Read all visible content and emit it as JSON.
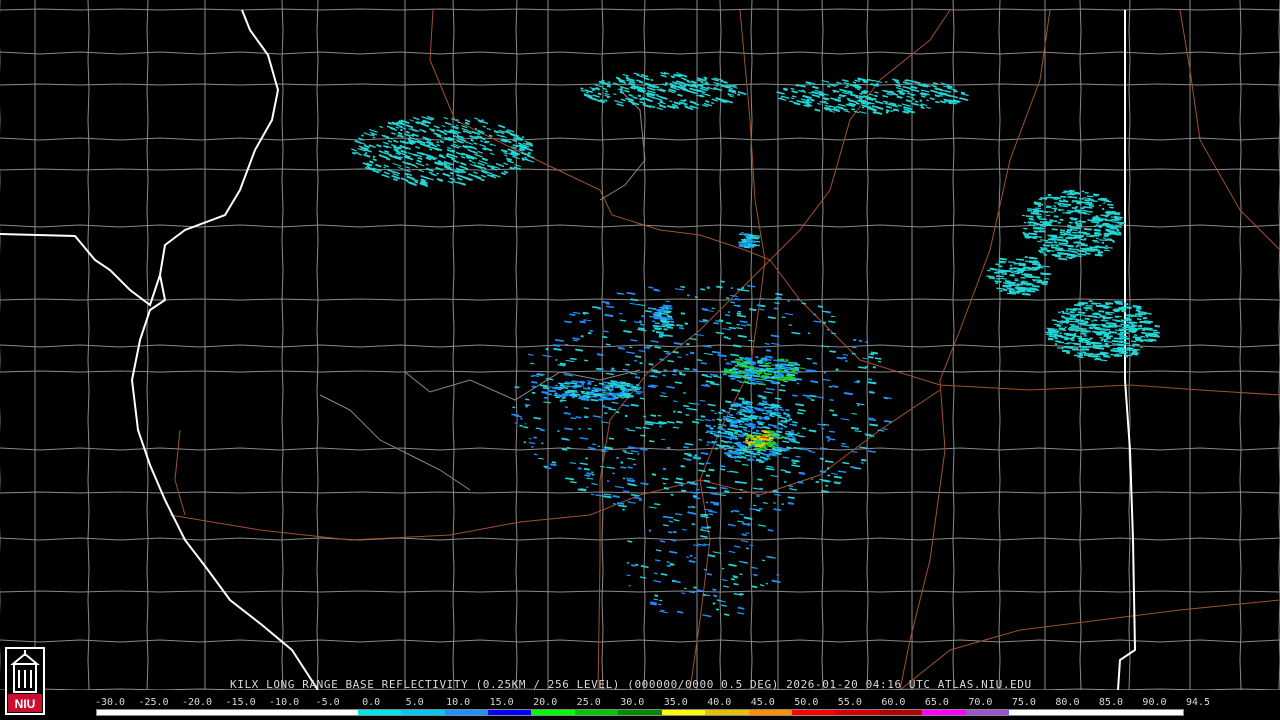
{
  "product": {
    "caption": "KILX LONG RANGE BASE REFLECTIVITY (0.25KM / 256 LEVEL) (000000/0000 0.5 DEG) 2026-01-20 04:16 UTC  ATLAS.NIU.EDU"
  },
  "logo": {
    "text": "NIU",
    "color": "#c8102e"
  },
  "scale": {
    "labels": [
      "-30.0",
      "-25.0",
      "-20.0",
      "-15.0",
      "-10.0",
      "-5.0",
      "0.0",
      "5.0",
      "10.0",
      "15.0",
      "20.0",
      "25.0",
      "30.0",
      "35.0",
      "40.0",
      "45.0",
      "50.0",
      "55.0",
      "60.0",
      "65.0",
      "70.0",
      "75.0",
      "80.0",
      "85.0",
      "90.0",
      "94.5"
    ],
    "colors": [
      "#ffffff",
      "#ffffff",
      "#ffffff",
      "#ffffff",
      "#ffffff",
      "#ffffff",
      "#00e6e6",
      "#00c8f0",
      "#1e90ff",
      "#0000ff",
      "#00ff00",
      "#00c800",
      "#008c00",
      "#ffff00",
      "#e8c000",
      "#ff9000",
      "#ff0000",
      "#d40000",
      "#b40000",
      "#ff00ff",
      "#9955c9",
      "#ffffff",
      "#ffffff",
      "#ffffff",
      "#ffffff"
    ]
  },
  "map_colors": {
    "county": "#8a8a8a",
    "state": "#ffffff",
    "highway": "#a0522d",
    "echo_light": "#22d6d6",
    "echo_mid": "#1e8fff",
    "echo_green": "#22cc22",
    "echo_yellow": "#e8d000",
    "echo_red": "#ff2a00"
  }
}
